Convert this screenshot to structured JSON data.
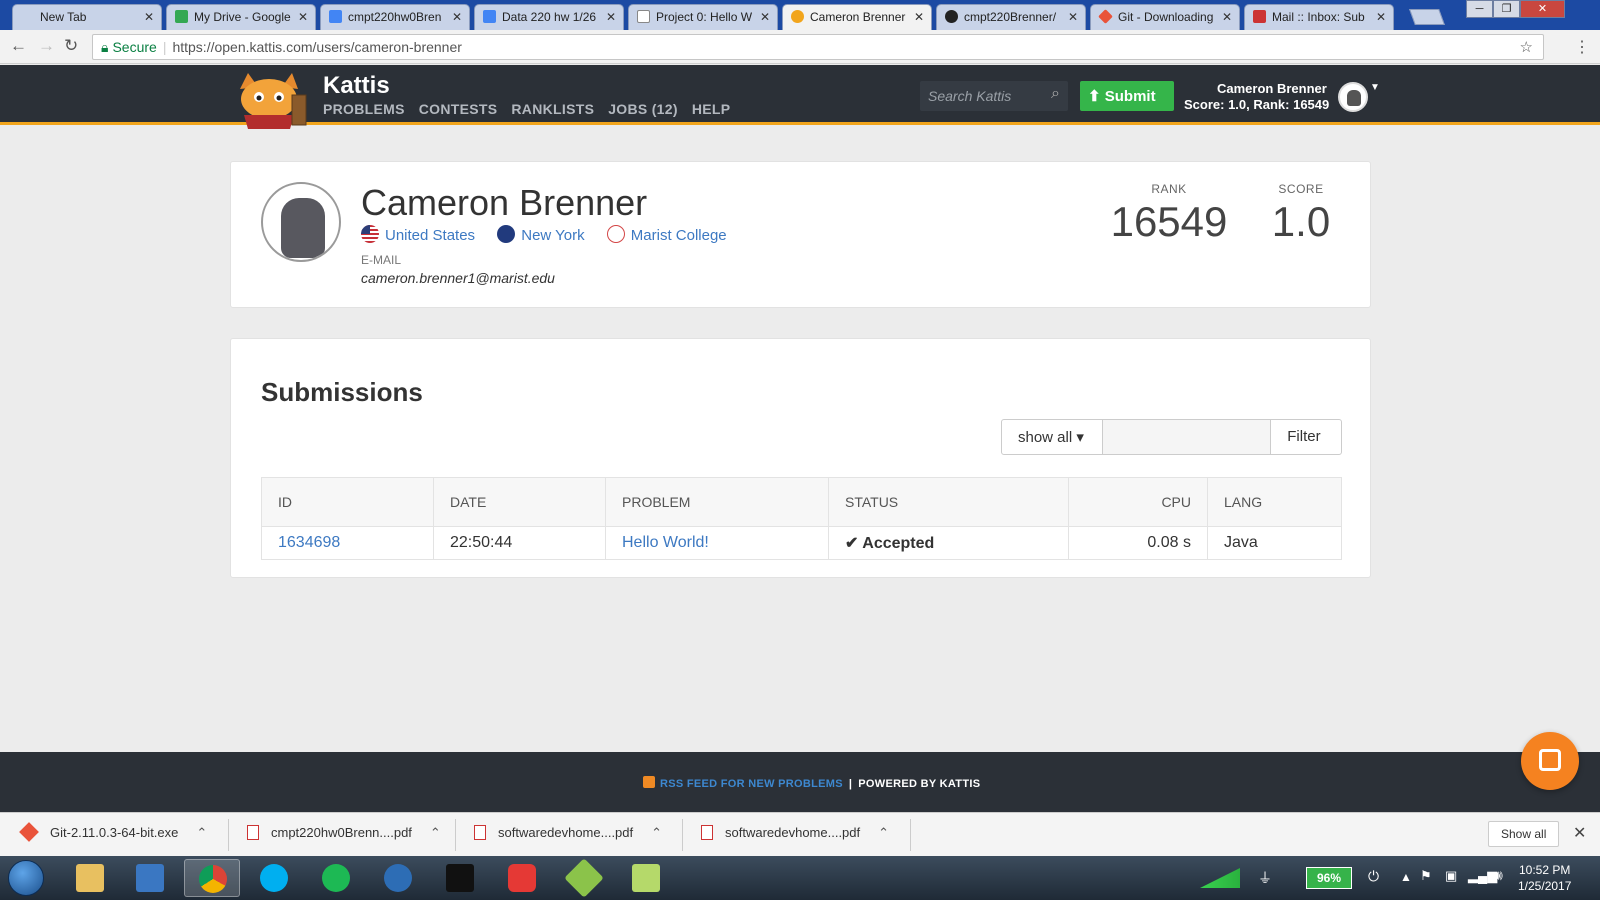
{
  "browser": {
    "tabs": [
      {
        "label": "New Tab",
        "favicon_color": "#f2f2f2"
      },
      {
        "label": "My Drive - Google",
        "favicon_color": "#34a853"
      },
      {
        "label": "cmpt220hw0Bren",
        "favicon_color": "#4285f4"
      },
      {
        "label": "Data 220 hw 1/26",
        "favicon_color": "#4285f4"
      },
      {
        "label": "Project 0: Hello W",
        "favicon_color": "#ffffff"
      },
      {
        "label": "Cameron Brenner",
        "favicon_color": "#f2a51c"
      },
      {
        "label": "cmpt220Brenner/",
        "favicon_color": "#222222"
      },
      {
        "label": "Git - Downloading",
        "favicon_color": "#e9533a"
      },
      {
        "label": "Mail :: Inbox: Sub",
        "favicon_color": "#c33333"
      }
    ],
    "active_tab_index": 5,
    "address": {
      "secure_label": "Secure",
      "url": "https://open.kattis.com/users/cameron-brenner"
    }
  },
  "kattis": {
    "brand": "Kattis",
    "nav": [
      "PROBLEMS",
      "CONTESTS",
      "RANKLISTS",
      "JOBS (12)",
      "HELP"
    ],
    "search_placeholder": "Search Kattis",
    "submit_label": "Submit",
    "user_name": "Cameron Brenner",
    "user_stats": "Score: 1.0, Rank: 16549",
    "accent_color": "#f2a51c"
  },
  "profile": {
    "name": "Cameron Brenner",
    "country": "United States",
    "region": "New York",
    "school": "Marist College",
    "email_label": "E-MAIL",
    "email": "cameron.brenner1@marist.edu",
    "rank_label": "RANK",
    "rank": "16549",
    "score_label": "SCORE",
    "score": "1.0"
  },
  "submissions": {
    "title": "Submissions",
    "filter_dropdown": "show all",
    "filter_button": "Filter",
    "columns": [
      "ID",
      "DATE",
      "PROBLEM",
      "STATUS",
      "CPU",
      "LANG"
    ],
    "rows": [
      {
        "id": "1634698",
        "date": "22:50:44",
        "problem": "Hello World!",
        "status": "Accepted",
        "cpu": "0.08 s",
        "lang": "Java"
      }
    ],
    "status_color": "#35a040"
  },
  "footer": {
    "rss_label": "RSS FEED FOR NEW PROBLEMS",
    "powered_label": "POWERED BY KATTIS"
  },
  "downloads": {
    "items": [
      {
        "name": "Git-2.11.0.3-64-bit.exe",
        "type": "exe"
      },
      {
        "name": "cmpt220hw0Brenn....pdf",
        "type": "pdf"
      },
      {
        "name": "softwaredevhome....pdf",
        "type": "pdf"
      },
      {
        "name": "softwaredevhome....pdf",
        "type": "pdf"
      }
    ],
    "show_all_label": "Show all"
  },
  "taskbar": {
    "battery": "96%",
    "time": "10:52 PM",
    "date": "1/25/2017"
  }
}
